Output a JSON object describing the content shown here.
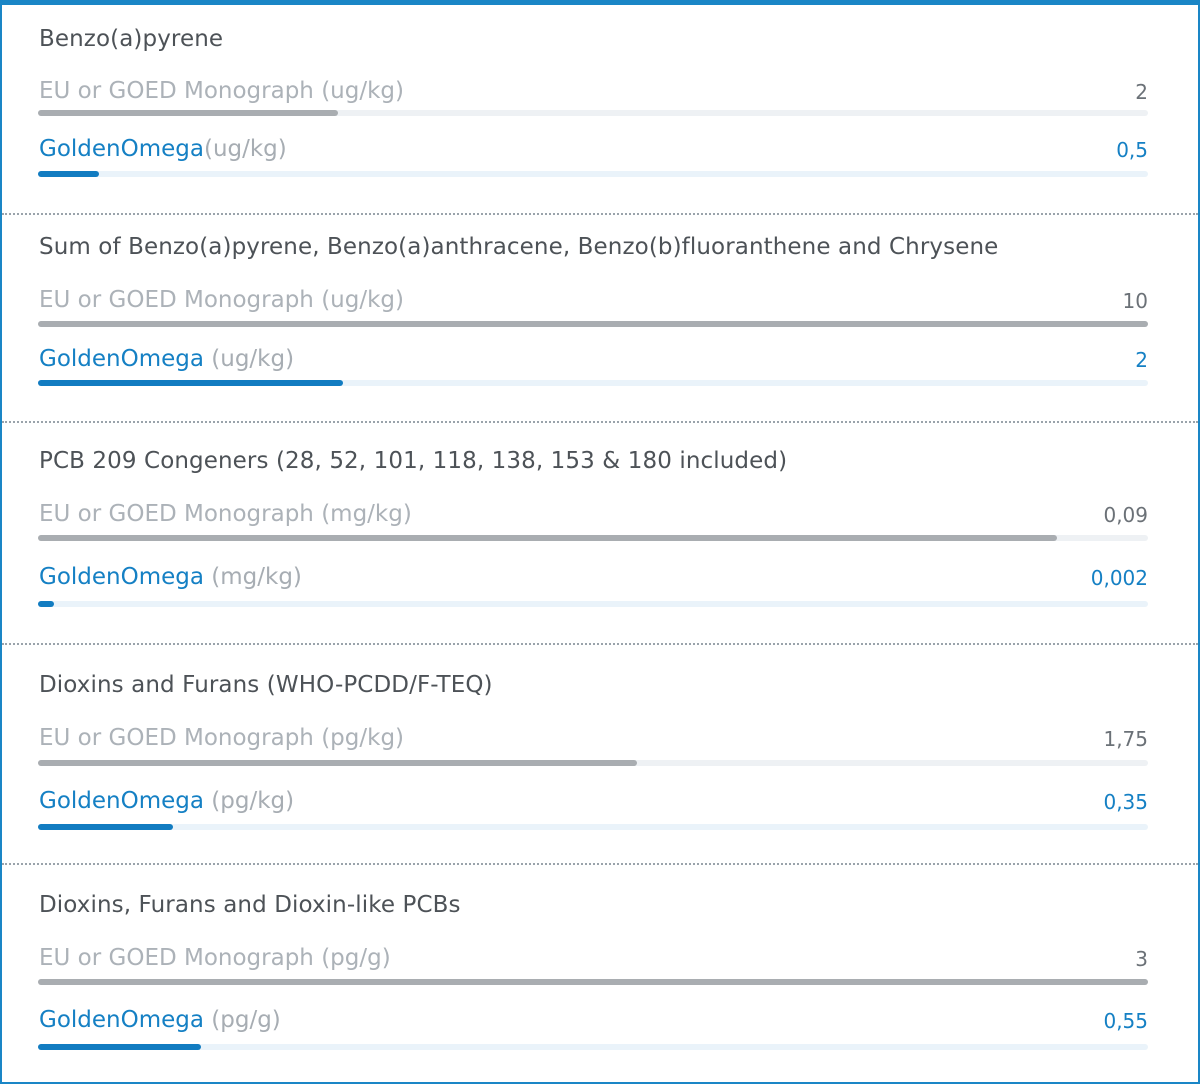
{
  "chart_data": {
    "type": "bar",
    "orientation": "horizontal",
    "groups": [
      {
        "title": "Benzo(a)pyrene",
        "eu_label": "EU or GOED Monograph (ug/kg)",
        "go_label": "GoldenOmega",
        "go_unit": "(ug/kg)",
        "eu_value": "2",
        "go_value": "0,5",
        "eu_level": 0.27,
        "go_level": 0.055
      },
      {
        "title": "Sum of Benzo(a)pyrene, Benzo(a)anthracene, Benzo(b)fluoranthene and Chrysene",
        "eu_label": "EU or GOED Monograph (ug/kg)",
        "go_label": "GoldenOmega",
        "go_unit": " (ug/kg)",
        "eu_value": "10",
        "go_value": "2",
        "eu_level": 1.0,
        "go_level": 0.275
      },
      {
        "title": "PCB 209 Congeners (28, 52, 101, 118, 138, 153 & 180 included)",
        "eu_label": "EU or GOED Monograph (mg/kg)",
        "go_label": "GoldenOmega",
        "go_unit": " (mg/kg)",
        "eu_value": "0,09",
        "go_value": "0,002",
        "eu_level": 0.918,
        "go_level": 0.014
      },
      {
        "title": "Dioxins and Furans (WHO-PCDD/F-TEQ)",
        "eu_label": "EU or GOED Monograph (pg/kg)",
        "go_label": "GoldenOmega",
        "go_unit": " (pg/kg)",
        "eu_value": "1,75",
        "go_value": "0,35",
        "eu_level": 0.54,
        "go_level": 0.122
      },
      {
        "title": "Dioxins, Furans and Dioxin-like PCBs",
        "eu_label": "EU or GOED Monograph (pg/g)",
        "go_label": "GoldenOmega",
        "go_unit": " (pg/g)",
        "eu_value": "3",
        "go_value": "0,55",
        "eu_level": 1.0,
        "go_level": 0.147
      }
    ]
  },
  "colors": {
    "accent": "#1580c4",
    "reference_bar": "#a9adb1",
    "golden_omega_bar": "#127cc1",
    "track": "#eef1f4"
  }
}
